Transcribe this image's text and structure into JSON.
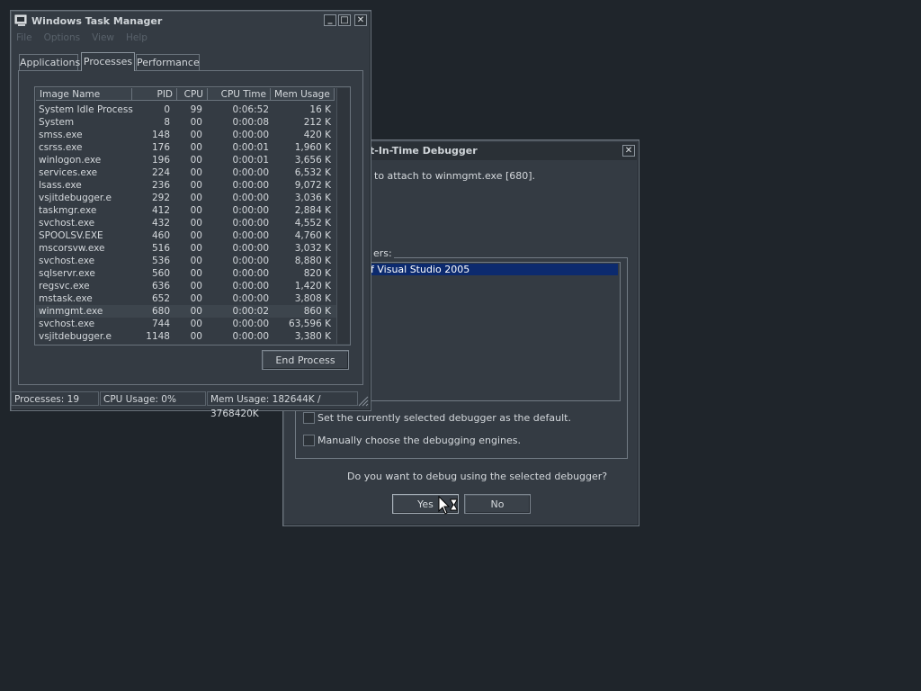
{
  "task_manager": {
    "title": "Windows Task Manager",
    "menu": [
      "File",
      "Options",
      "View",
      "Help"
    ],
    "tabs": [
      "Applications",
      "Processes",
      "Performance"
    ],
    "columns": [
      "Image Name",
      "PID",
      "CPU",
      "CPU Time",
      "Mem Usage"
    ],
    "rows": [
      {
        "name": "System Idle Process",
        "pid": "0",
        "cpu": "99",
        "time": "0:06:52",
        "mem": "16 K"
      },
      {
        "name": "System",
        "pid": "8",
        "cpu": "00",
        "time": "0:00:08",
        "mem": "212 K"
      },
      {
        "name": "smss.exe",
        "pid": "148",
        "cpu": "00",
        "time": "0:00:00",
        "mem": "420 K"
      },
      {
        "name": "csrss.exe",
        "pid": "176",
        "cpu": "00",
        "time": "0:00:01",
        "mem": "1,960 K"
      },
      {
        "name": "winlogon.exe",
        "pid": "196",
        "cpu": "00",
        "time": "0:00:01",
        "mem": "3,656 K"
      },
      {
        "name": "services.exe",
        "pid": "224",
        "cpu": "00",
        "time": "0:00:00",
        "mem": "6,532 K"
      },
      {
        "name": "lsass.exe",
        "pid": "236",
        "cpu": "00",
        "time": "0:00:00",
        "mem": "9,072 K"
      },
      {
        "name": "vsjitdebugger.e",
        "pid": "292",
        "cpu": "00",
        "time": "0:00:00",
        "mem": "3,036 K"
      },
      {
        "name": "taskmgr.exe",
        "pid": "412",
        "cpu": "00",
        "time": "0:00:00",
        "mem": "2,884 K"
      },
      {
        "name": "svchost.exe",
        "pid": "432",
        "cpu": "00",
        "time": "0:00:00",
        "mem": "4,552 K"
      },
      {
        "name": "SPOOLSV.EXE",
        "pid": "460",
        "cpu": "00",
        "time": "0:00:00",
        "mem": "4,760 K"
      },
      {
        "name": "mscorsvw.exe",
        "pid": "516",
        "cpu": "00",
        "time": "0:00:00",
        "mem": "3,032 K"
      },
      {
        "name": "svchost.exe",
        "pid": "536",
        "cpu": "00",
        "time": "0:00:00",
        "mem": "8,880 K"
      },
      {
        "name": "sqlservr.exe",
        "pid": "560",
        "cpu": "00",
        "time": "0:00:00",
        "mem": "820 K"
      },
      {
        "name": "regsvc.exe",
        "pid": "636",
        "cpu": "00",
        "time": "0:00:00",
        "mem": "1,420 K"
      },
      {
        "name": "mstask.exe",
        "pid": "652",
        "cpu": "00",
        "time": "0:00:00",
        "mem": "3,808 K"
      },
      {
        "name": "winmgmt.exe",
        "pid": "680",
        "cpu": "00",
        "time": "0:00:02",
        "mem": "860 K"
      },
      {
        "name": "svchost.exe",
        "pid": "744",
        "cpu": "00",
        "time": "0:00:00",
        "mem": "63,596 K"
      },
      {
        "name": "vsjitdebugger.e",
        "pid": "1148",
        "cpu": "00",
        "time": "0:00:00",
        "mem": "3,380 K"
      }
    ],
    "end_process_label": "End Process",
    "status": {
      "processes": "Processes: 19",
      "cpu": "CPU Usage: 0%",
      "mem": "Mem Usage: 182644K / 3768420K"
    }
  },
  "debugger": {
    "title": "t-In-Time Debugger",
    "message": "to attach to winmgmt.exe [680].",
    "group_label": "ers:",
    "list_item": "f Visual Studio 2005",
    "checkbox_default": "Set the currently selected debugger as the default.",
    "checkbox_manual": "Manually choose the debugging engines.",
    "question": "Do you want to debug using the selected debugger?",
    "yes_label": "Yes",
    "no_label": "No"
  }
}
